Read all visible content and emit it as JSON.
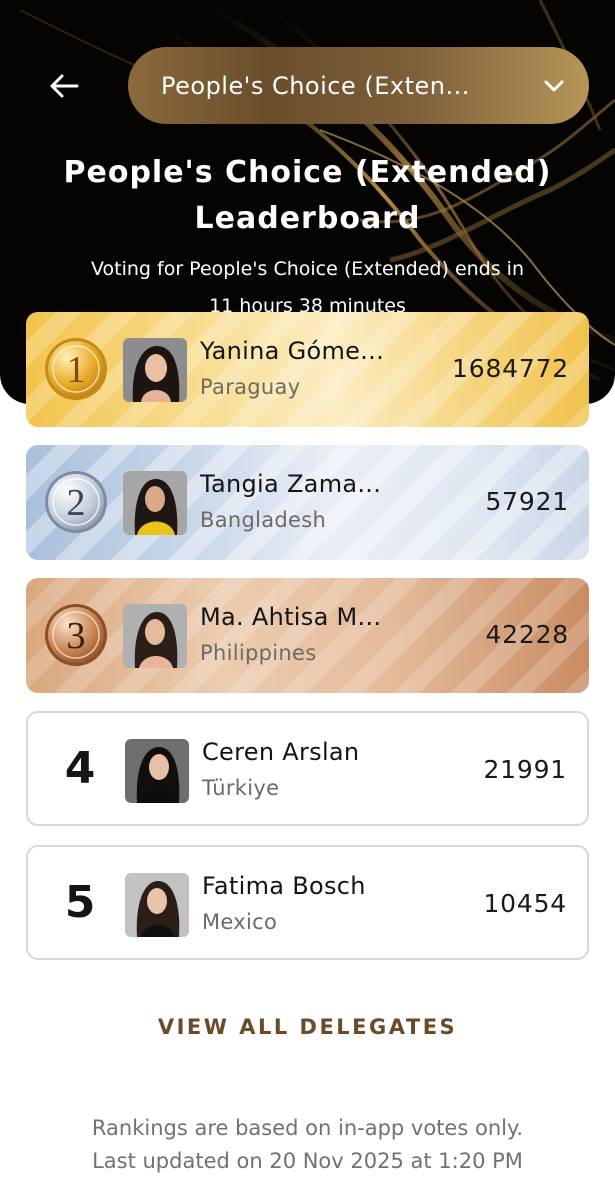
{
  "header": {
    "back_icon": "arrow-left-icon",
    "dropdown": {
      "selected": "People's Choice (Exten...",
      "chevron_icon": "chevron-down-icon"
    },
    "title_line1": "People's Choice (Extended)",
    "title_line2": "Leaderboard",
    "voting_text": "Voting for People's Choice (Extended) ends in",
    "voting_time": "11 hours 38 minutes"
  },
  "leaderboard": [
    {
      "rank": "1",
      "name": "Yanina Góme...",
      "country": "Paraguay",
      "votes": "1684772",
      "tier": "gold"
    },
    {
      "rank": "2",
      "name": "Tangia Zama...",
      "country": "Bangladesh",
      "votes": "57921",
      "tier": "silver"
    },
    {
      "rank": "3",
      "name": "Ma. Ahtisa M...",
      "country": "Philippines",
      "votes": "42228",
      "tier": "bronze"
    },
    {
      "rank": "4",
      "name": "Ceren Arslan",
      "country": "Türkiye",
      "votes": "21991",
      "tier": "none"
    },
    {
      "rank": "5",
      "name": "Fatima Bosch",
      "country": "Mexico",
      "votes": "10454",
      "tier": "none"
    }
  ],
  "view_all_label": "VIEW ALL DELEGATES",
  "footnote": {
    "line1": "Rankings are based on in-app votes only.",
    "line2": "Last updated on 20 Nov 2025 at 1:20 PM"
  },
  "colors": {
    "hero_bg": "#050403",
    "accent_brown": "#6b4a26",
    "gold": "#f3c34a",
    "silver": "#a9bfdc",
    "bronze": "#d9a77d"
  }
}
